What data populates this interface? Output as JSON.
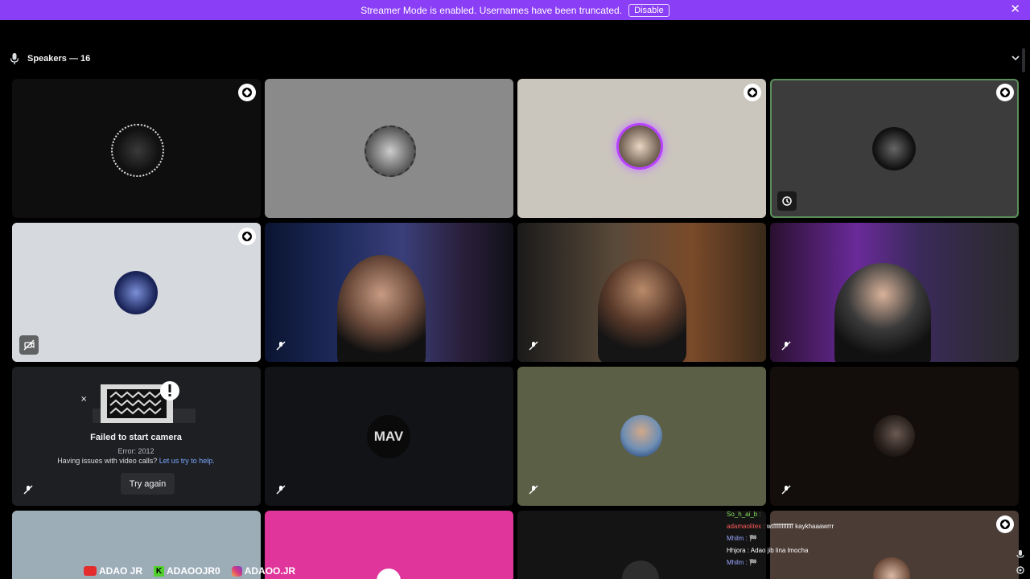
{
  "banner": {
    "message": "Streamer Mode is enabled. Usernames have been truncated.",
    "disable_label": "Disable",
    "close_glyph": "✕",
    "color": "#8a3ef5"
  },
  "speakers": {
    "label": "Speakers — 16",
    "icon": "microphone-icon",
    "collapse_icon": "chevron-down-icon"
  },
  "failed_camera": {
    "title": "Failed to start camera",
    "error": "Error: 2012",
    "help_prefix": "Having issues with video calls?",
    "help_link": "Let us try to help.",
    "retry_label": "Try again"
  },
  "avatars": {
    "mav_text": "MAV"
  },
  "overlay_chat": [
    {
      "user": "So_h_ai_b :",
      "text": "",
      "cls": "u1"
    },
    {
      "user": "adamaolitex :",
      "text": "wtffffffffffff kaykhaaawrrr",
      "cls": "u2"
    },
    {
      "user": "Mhilm :",
      "text": "🏁",
      "cls": "u3"
    },
    {
      "user": "Hhjora :",
      "text": "Adao jib lina lmocha",
      "cls": "u4"
    },
    {
      "user": "Mhilm :",
      "text": "🏁",
      "cls": "u3"
    }
  ],
  "socials": [
    {
      "icon": "youtube-icon",
      "handle": "ADAO JR"
    },
    {
      "icon": "kick-icon",
      "handle": "ADAOOJR0"
    },
    {
      "icon": "instagram-icon",
      "handle": "ADAOO.JR"
    }
  ],
  "colors": {
    "selected_outline": "#5b8f5a",
    "link": "#7aa7ff"
  }
}
